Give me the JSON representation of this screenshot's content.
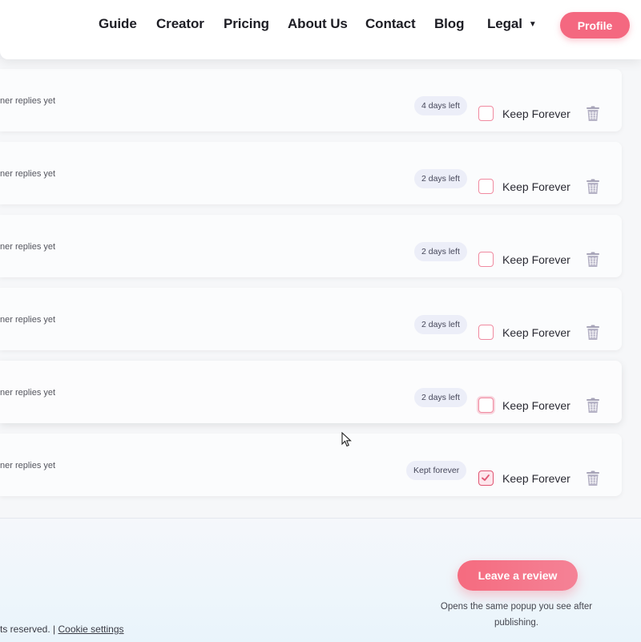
{
  "nav": {
    "links": [
      "Guide",
      "Creator",
      "Pricing",
      "About Us",
      "Contact",
      "Blog"
    ],
    "legal_label": "Legal",
    "profile_label": "Profile"
  },
  "rows": [
    {
      "replies": "ner replies yet",
      "badge": "4 days left",
      "keep_label": "Keep Forever",
      "checked": false
    },
    {
      "replies": "ner replies yet",
      "badge": "2 days left",
      "keep_label": "Keep Forever",
      "checked": false
    },
    {
      "replies": "ner replies yet",
      "badge": "2 days left",
      "keep_label": "Keep Forever",
      "checked": false
    },
    {
      "replies": "ner replies yet",
      "badge": "2 days left",
      "keep_label": "Keep Forever",
      "checked": false
    },
    {
      "replies": "ner replies yet",
      "badge": "2 days left",
      "keep_label": "Keep Forever",
      "checked": false
    },
    {
      "replies": "ner replies yet",
      "badge": "Kept forever",
      "keep_label": "Keep Forever",
      "checked": true
    }
  ],
  "footer": {
    "review_button": "Leave a review",
    "review_note": "Opens the same popup you see after publishing.",
    "copyright_text": "ts reserved. | ",
    "cookie_link": "Cookie settings"
  },
  "colors": {
    "accent": "#f46880",
    "badge_bg": "#eceef8",
    "checkbox_border": "#f08aa0",
    "trash": "#a7a4b8"
  }
}
